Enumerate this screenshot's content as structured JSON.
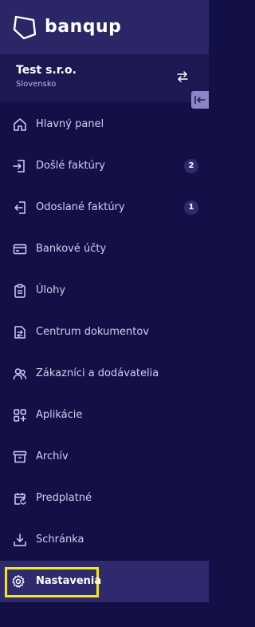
{
  "brand": {
    "name": "banqup",
    "logo_icon": "banqup-logo-icon"
  },
  "company": {
    "name": "Test s.r.o.",
    "country": "Slovensko",
    "switch_icon": "switch-company-icon"
  },
  "collapse_icon": "collapse-sidebar-icon",
  "nav": {
    "items": [
      {
        "label": "Hlavný panel",
        "icon": "home-icon"
      },
      {
        "label": "Došlé faktúry",
        "icon": "incoming-invoice-icon",
        "badge": "2"
      },
      {
        "label": "Odoslané faktúry",
        "icon": "outgoing-invoice-icon",
        "badge": "1"
      },
      {
        "label": "Bankové účty",
        "icon": "credit-card-icon"
      },
      {
        "label": "Úlohy",
        "icon": "clipboard-icon"
      },
      {
        "label": "Centrum dokumentov",
        "icon": "document-exchange-icon"
      },
      {
        "label": "Zákazníci a dodávatelia",
        "icon": "contacts-icon"
      },
      {
        "label": "Aplikácie",
        "icon": "apps-icon"
      },
      {
        "label": "Archív",
        "icon": "archive-icon"
      },
      {
        "label": "Predplatné",
        "icon": "calendar-refresh-icon"
      },
      {
        "label": "Schránka",
        "icon": "inbox-download-icon"
      },
      {
        "label": "Nastavenia",
        "icon": "gear-icon",
        "active": true
      }
    ]
  },
  "colors": {
    "background": "#131046",
    "header": "#2b2767",
    "active": "#2f2a6e",
    "highlight": "#f6ea00"
  }
}
